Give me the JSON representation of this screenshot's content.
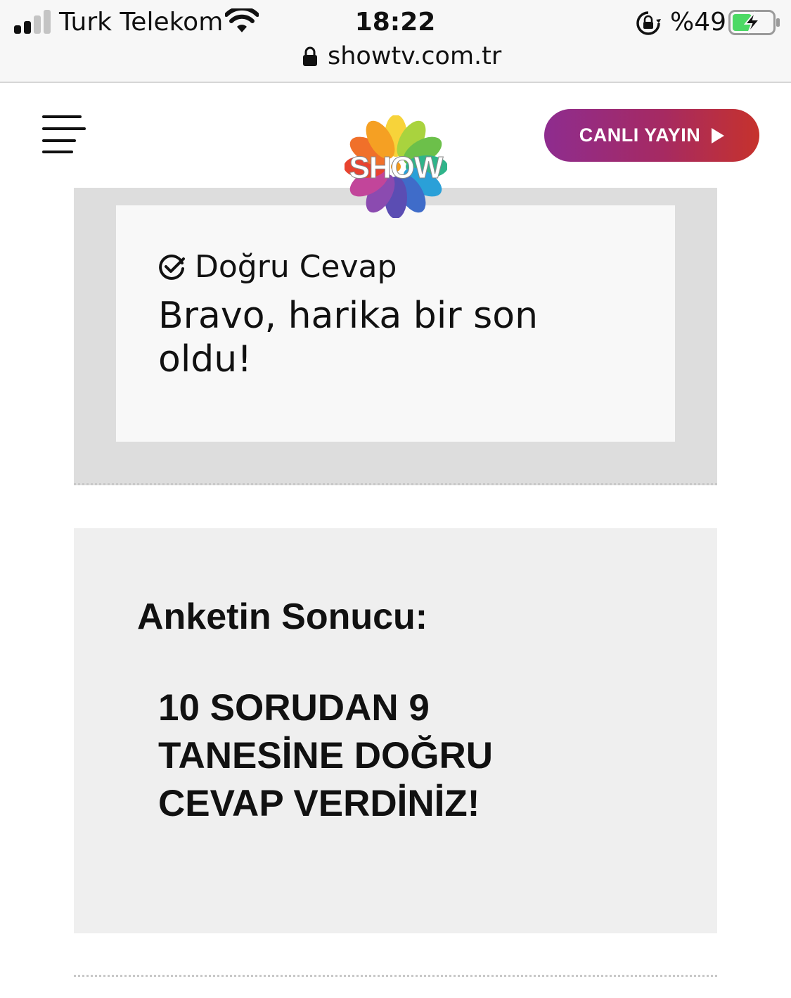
{
  "status_bar": {
    "carrier": "Turk Telekom",
    "time": "18:22",
    "battery_percent": "%49",
    "signal_bars_filled": 2,
    "signal_bars_total": 4,
    "battery_level": 0.49,
    "icons": [
      "signal-icon",
      "wifi-icon",
      "rotation-lock-icon",
      "battery-charging-icon"
    ]
  },
  "browser": {
    "url": "showtv.com.tr",
    "icons": [
      "lock-icon"
    ]
  },
  "header": {
    "menu_icon": "hamburger-menu-icon",
    "logo_text": "SHOW",
    "live_button_label": "CANLI YAYIN",
    "live_button_icon": "play-icon",
    "colors": {
      "live_gradient_start": "#8e2c8f",
      "live_gradient_end": "#c6322c"
    }
  },
  "answer": {
    "status_icon": "check-circle-icon",
    "status_label": "Doğru Cevap",
    "message": "Bravo, harika bir son oldu!"
  },
  "result": {
    "title": "Anketin Sonucu:",
    "text": "10 SORUDAN 9 TANESİNE DOĞRU CEVAP VERDİNİZ!"
  }
}
